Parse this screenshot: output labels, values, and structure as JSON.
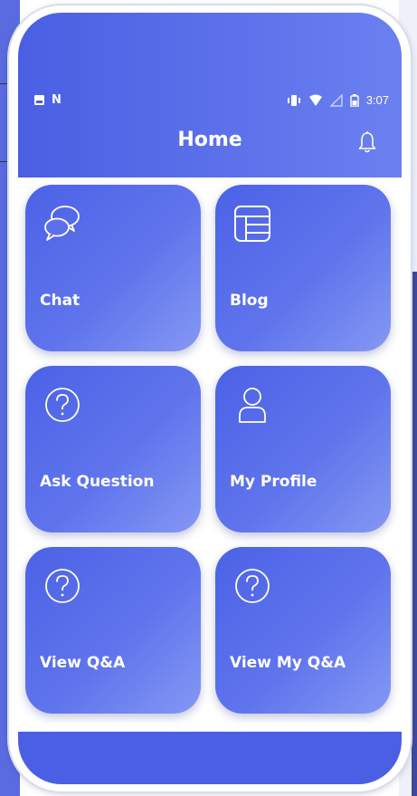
{
  "status_bar": {
    "time": "3:07",
    "left_icons": [
      "gallery-icon",
      "n-icon"
    ],
    "right_icons": [
      "vibrate-icon",
      "wifi-icon",
      "signal-icon",
      "battery-icon"
    ]
  },
  "header": {
    "title": "Home",
    "bell_icon": "bell-icon"
  },
  "tiles": [
    {
      "label": "Chat",
      "icon": "chat-icon"
    },
    {
      "label": "Blog",
      "icon": "blog-icon"
    },
    {
      "label": "Ask Question",
      "icon": "question-icon"
    },
    {
      "label": "My Profile",
      "icon": "profile-icon"
    },
    {
      "label": "View Q&A",
      "icon": "question-icon"
    },
    {
      "label": "View My Q&A",
      "icon": "question-icon"
    }
  ],
  "colors": {
    "primary": "#4a5fe3",
    "tile_gradient_end": "#8598f4",
    "text": "#ffffff"
  }
}
